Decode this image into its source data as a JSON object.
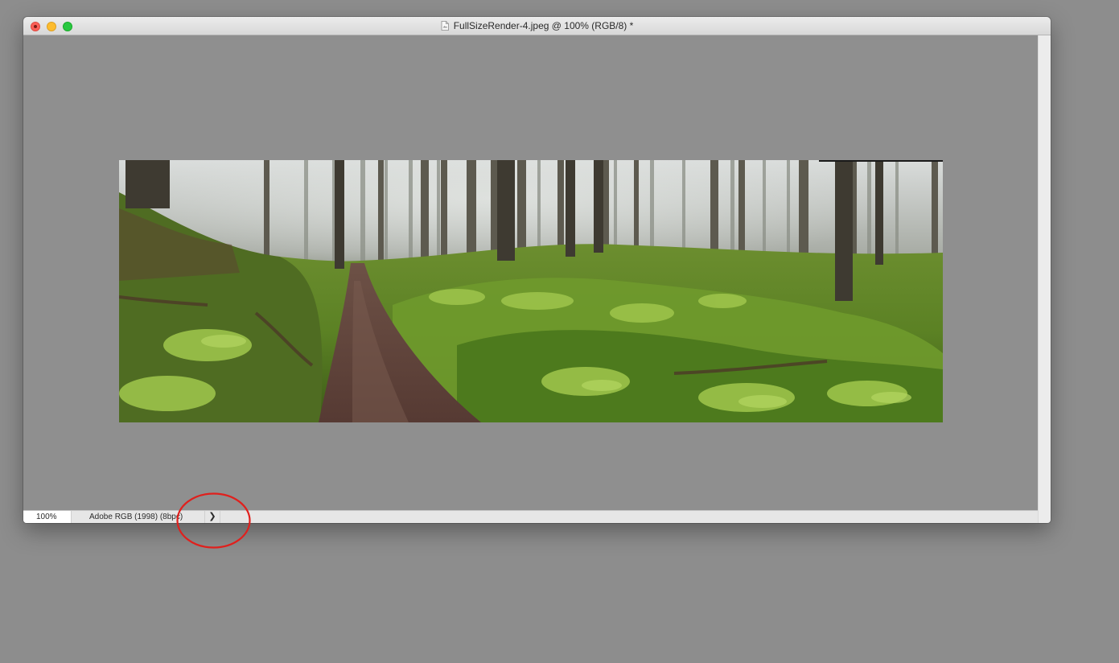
{
  "window": {
    "title": "FullSizeRender-4.jpeg @ 100% (RGB/8) *"
  },
  "status_bar": {
    "zoom_level": "100%",
    "document_profile": "Adobe RGB (1998) (8bpc)",
    "expand_glyph": "❯"
  },
  "colors": {
    "desktop_bg": "#8d8d8d",
    "canvas_bg": "#8f8f8f",
    "annotation_circle": "#e0201d"
  },
  "icons": {
    "document": "document-icon",
    "status_expand": "chevron-right-icon"
  }
}
